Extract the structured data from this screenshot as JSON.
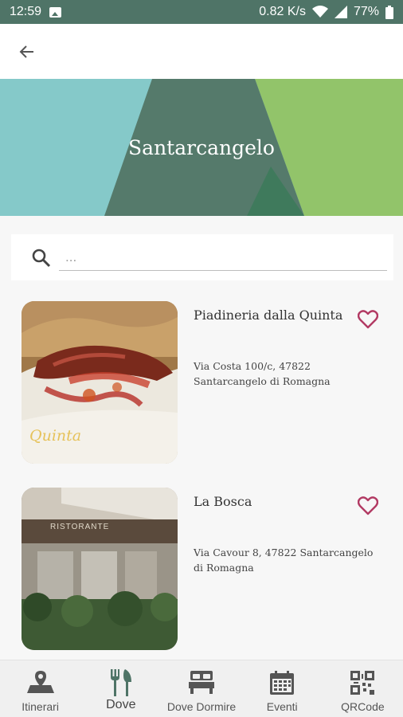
{
  "status_bar": {
    "time": "12:59",
    "network_speed": "0.82 K/s",
    "battery": "77%"
  },
  "header": {
    "title": "Santarcangelo",
    "back_icon": "arrow-left-icon",
    "colors": {
      "left": "#85c9c9",
      "center": "#557a6b",
      "right": "#92c46a"
    }
  },
  "search": {
    "placeholder": "...",
    "value": ""
  },
  "places": [
    {
      "name": "Piadineria dalla Quinta",
      "address": "Via Costa 100/c, 47822 Santarcangelo di Romagna",
      "image_caption": "Quinta",
      "favorite_icon": "heart-outline-icon"
    },
    {
      "name": "La Bosca",
      "address": "Via Cavour 8, 47822 Santarcangelo di Romagna",
      "image_caption": "RISTORANTE",
      "favorite_icon": "heart-outline-icon"
    }
  ],
  "bottom_nav": [
    {
      "label": "Itinerari",
      "icon": "map-pin-icon",
      "active": false
    },
    {
      "label": "Dove",
      "icon": "fork-knife-icon",
      "active": true
    },
    {
      "label": "Dove Dormire",
      "icon": "bed-icon",
      "active": false
    },
    {
      "label": "Eventi",
      "icon": "calendar-icon",
      "active": false
    },
    {
      "label": "QRCode",
      "icon": "qr-code-icon",
      "active": false
    }
  ],
  "colors": {
    "accent_heart": "#b23a63",
    "status_bar": "#4f7467"
  }
}
